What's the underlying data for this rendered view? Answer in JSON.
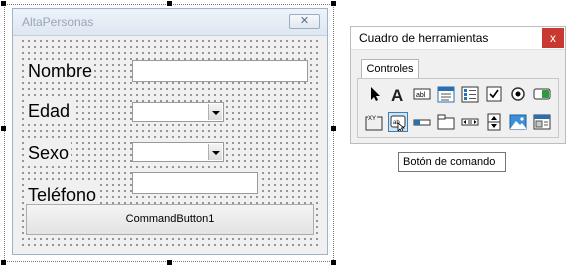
{
  "form": {
    "title": "AltaPersonas",
    "close_glyph": "✕",
    "labels": {
      "nombre": "Nombre",
      "edad": "Edad",
      "sexo": "Sexo",
      "telefono": "Teléfono"
    },
    "command_button_label": "CommandButton1"
  },
  "toolbox": {
    "title": "Cuadro de herramientas",
    "close_glyph": "x",
    "tab_label": "Controles",
    "tools_row1": [
      "pointer-icon",
      "label-icon",
      "textbox-icon",
      "combobox-icon",
      "listbox-icon",
      "checkbox-icon",
      "optionbutton-icon",
      "togglebutton-icon"
    ],
    "tools_row2": [
      "frame-icon",
      "commandbutton-icon",
      "tabstrip-icon",
      "multipage-icon",
      "scrollbar-icon",
      "spinbutton-icon",
      "image-icon",
      "refedit-icon"
    ],
    "selected_tool": "commandbutton-icon",
    "tooltip": "Botón de comando",
    "accent_color": "#c9392f"
  }
}
